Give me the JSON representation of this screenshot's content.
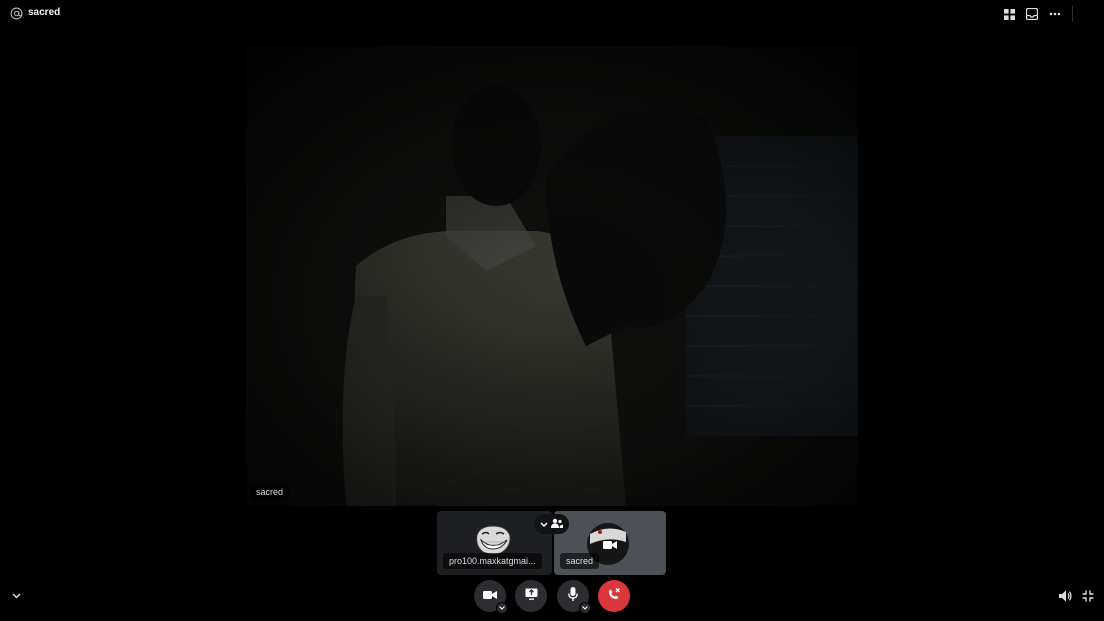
{
  "header": {
    "channel_name": "sacred",
    "icons": [
      "at-sign-icon",
      "grid-layout-icon",
      "inbox-icon",
      "more-options-icon"
    ]
  },
  "main_video": {
    "participant_label": "sacred"
  },
  "participants": [
    {
      "name": "pro100.maxkatgmai...",
      "avatar": "troll-face-avatar"
    },
    {
      "name": "sacred",
      "avatar": "camera-icon"
    }
  ],
  "controls": {
    "icons": [
      "camera-icon",
      "screen-share-icon",
      "microphone-icon",
      "end-call-icon"
    ],
    "end_call_color": "#da373c"
  },
  "corner_icons": [
    "chevron-down-icon",
    "volume-icon",
    "exit-fullscreen-icon"
  ]
}
